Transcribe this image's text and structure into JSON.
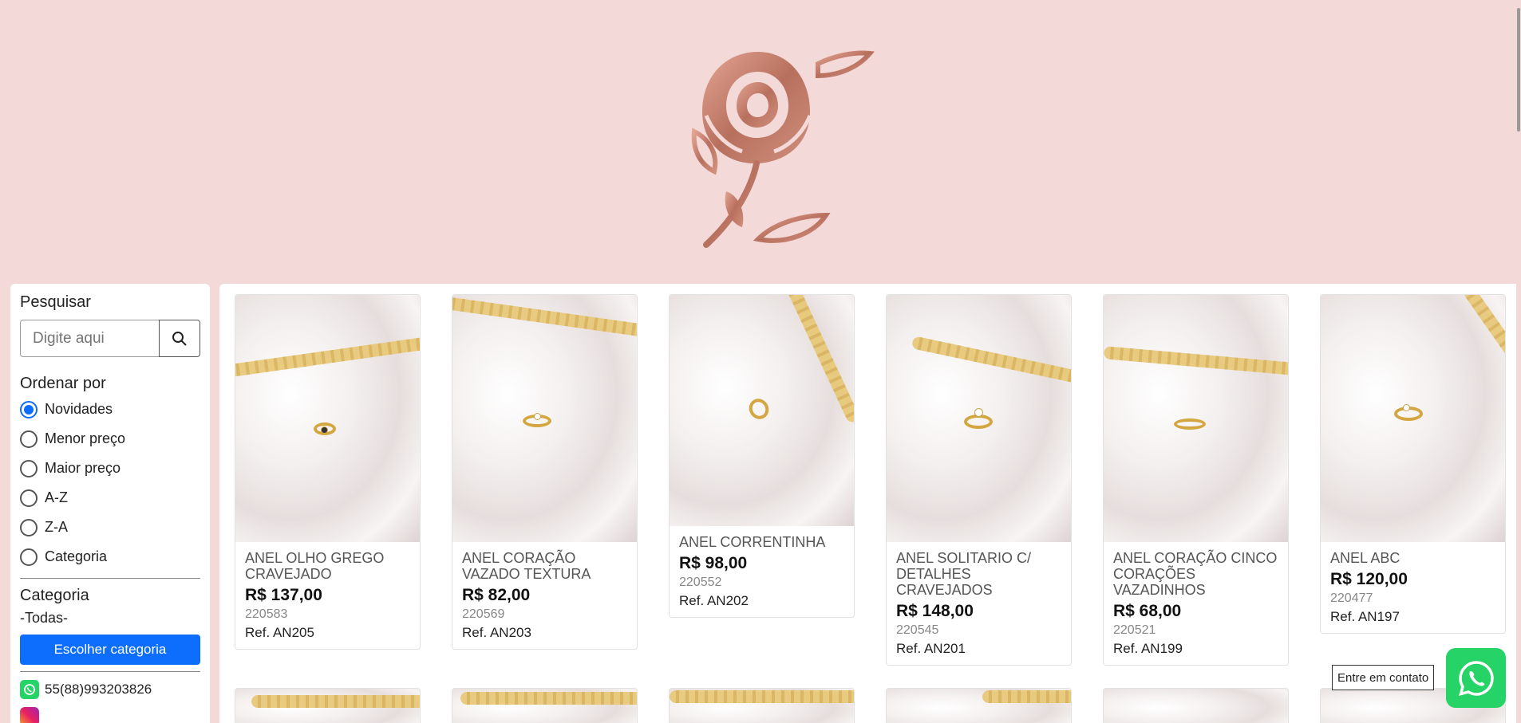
{
  "sidebar": {
    "search_label": "Pesquisar",
    "search_placeholder": "Digite aqui",
    "sort_label": "Ordenar por",
    "sort_options": [
      "Novidades",
      "Menor preço",
      "Maior preço",
      "A-Z",
      "Z-A",
      "Categoria"
    ],
    "sort_selected": "Novidades",
    "category_label": "Categoria",
    "category_current": "-Todas-",
    "category_button": "Escolher categoria",
    "phone": "55(88)993203826"
  },
  "products": [
    {
      "name": "ANEL OLHO GREGO CRAVEJADO",
      "price": "R$ 137,00",
      "code": "220583",
      "ref": "Ref. AN205"
    },
    {
      "name": "ANEL CORAÇÃO VAZADO TEXTURA",
      "price": "R$ 82,00",
      "code": "220569",
      "ref": "Ref. AN203"
    },
    {
      "name": "ANEL CORRENTINHA",
      "price": "R$ 98,00",
      "code": "220552",
      "ref": "Ref. AN202"
    },
    {
      "name": "ANEL SOLITARIO C/ DETALHES CRAVEJADOS",
      "price": "R$ 148,00",
      "code": "220545",
      "ref": "Ref. AN201"
    },
    {
      "name": "ANEL CORAÇÃO CINCO CORAÇÕES VAZADINHOS",
      "price": "R$ 68,00",
      "code": "220521",
      "ref": "Ref. AN199"
    },
    {
      "name": "ANEL ABC",
      "price": "R$ 120,00",
      "code": "220477",
      "ref": "Ref. AN197"
    }
  ],
  "contact_tooltip": "Entre em contato",
  "colors": {
    "accent": "#0d6efd",
    "whatsapp": "#25d366",
    "background": "#f4d9d9",
    "logo": "#c9826f"
  },
  "icons": [
    "rose-logo-icon",
    "search-icon",
    "whatsapp-icon",
    "instagram-icon"
  ]
}
